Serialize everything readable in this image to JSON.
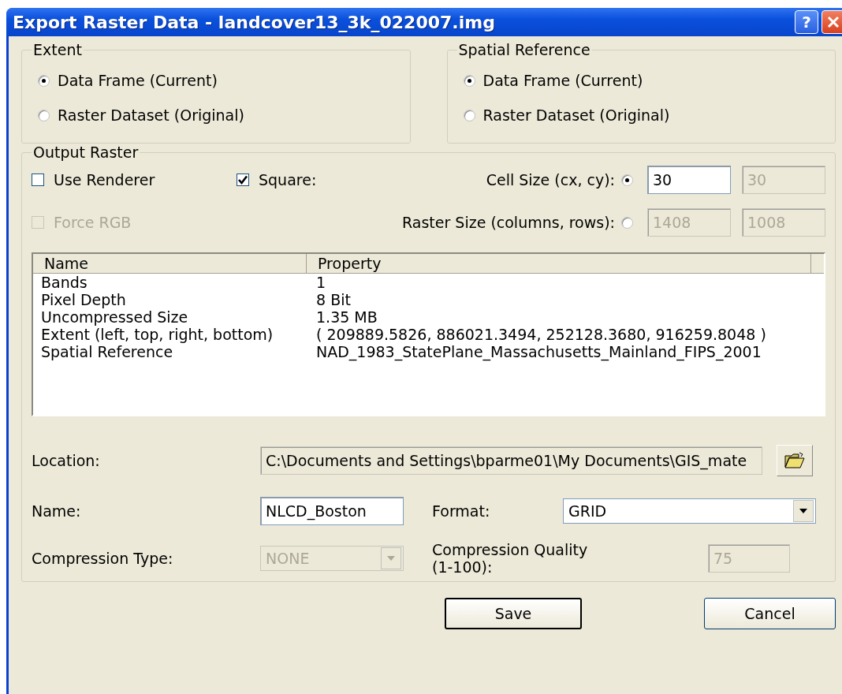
{
  "window": {
    "title": "Export Raster Data - landcover13_3k_022007.img",
    "help_button": "?"
  },
  "extent": {
    "label": "Extent",
    "options": [
      {
        "label": "Data Frame (Current)",
        "selected": true
      },
      {
        "label": "Raster Dataset (Original)",
        "selected": false
      }
    ]
  },
  "spatial_reference": {
    "label": "Spatial Reference",
    "options": [
      {
        "label": "Data Frame (Current)",
        "selected": true
      },
      {
        "label": "Raster Dataset (Original)",
        "selected": false
      }
    ]
  },
  "output_raster": {
    "label": "Output Raster",
    "checkboxes": [
      {
        "label": "Use Renderer",
        "checked": false,
        "disabled": false
      },
      {
        "label": "Square:",
        "checked": true,
        "disabled": false
      },
      {
        "label": "Force RGB",
        "checked": false,
        "disabled": true
      }
    ],
    "size_options": [
      {
        "label": "Cell Size (cx, cy):",
        "selected": true,
        "fields": [
          {
            "value": "30",
            "disabled": false
          },
          {
            "value": "30",
            "disabled": true
          }
        ]
      },
      {
        "label": "Raster Size (columns, rows):",
        "selected": false,
        "fields": [
          {
            "value": "1408",
            "disabled": true
          },
          {
            "value": "1008",
            "disabled": true
          }
        ]
      }
    ],
    "properties": {
      "columns": [
        "Name",
        "Property"
      ],
      "rows": [
        {
          "name": "Bands",
          "property": "1"
        },
        {
          "name": "Pixel Depth",
          "property": "8 Bit"
        },
        {
          "name": "Uncompressed Size",
          "property": "1.35 MB"
        },
        {
          "name": "Extent (left, top, right, bottom)",
          "property": "( 209889.5826, 886021.3494, 252128.3680, 916259.8048 )"
        },
        {
          "name": "Spatial Reference",
          "property": "NAD_1983_StatePlane_Massachusetts_Mainland_FIPS_2001"
        }
      ]
    },
    "location": {
      "label": "Location:",
      "value": "C:\\Documents and Settings\\bparme01\\My Documents\\GIS_mate"
    },
    "name": {
      "label": "Name:",
      "value": "NLCD_Boston"
    },
    "format": {
      "label": "Format:",
      "value": "GRID",
      "disabled": false
    },
    "compression_type": {
      "label": "Compression Type:",
      "value": "NONE",
      "disabled": true
    },
    "compression_quality": {
      "label": "Compression Quality (1-100):",
      "value": "75",
      "disabled": true
    }
  },
  "buttons": [
    {
      "label": "Save",
      "default": true
    },
    {
      "label": "Cancel",
      "default": false
    }
  ]
}
